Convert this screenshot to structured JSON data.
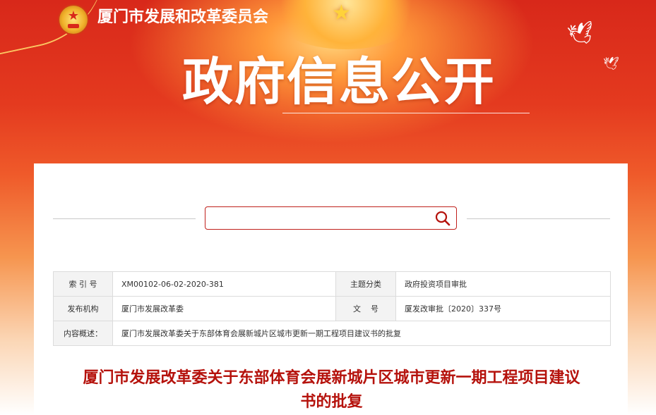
{
  "header": {
    "org_name": "厦门市发展和改革委员会",
    "big_title": "政府信息公开",
    "emblem_icon": "national-emblem-icon",
    "dove_icon": "dove-icon"
  },
  "search": {
    "value": "",
    "placeholder": "",
    "icon": "search-icon",
    "accent": "#c0201c"
  },
  "meta": {
    "index_label": "索 引 号",
    "index_value": "XM00102-06-02-2020-381",
    "topic_label": "主题分类",
    "topic_value": "政府投资项目审批",
    "publisher_label": "发布机构",
    "publisher_value": "厦门市发展改革委",
    "docno_label": "文    号",
    "docno_value": "厦发改审批〔2020〕337号",
    "summary_label": "内容概述：",
    "summary_value": "厦门市发展改革委关于东部体育会展新城片区城市更新一期工程项目建议书的批复"
  },
  "document": {
    "title_line1": "厦门市发展改革委关于东部体育会展新城片区城市更新一期工程项目建议",
    "title_line2": "书的批复",
    "title_color": "#b5120c"
  },
  "colors": {
    "banner_red": "#d8281a",
    "banner_orange": "#f6954f"
  }
}
